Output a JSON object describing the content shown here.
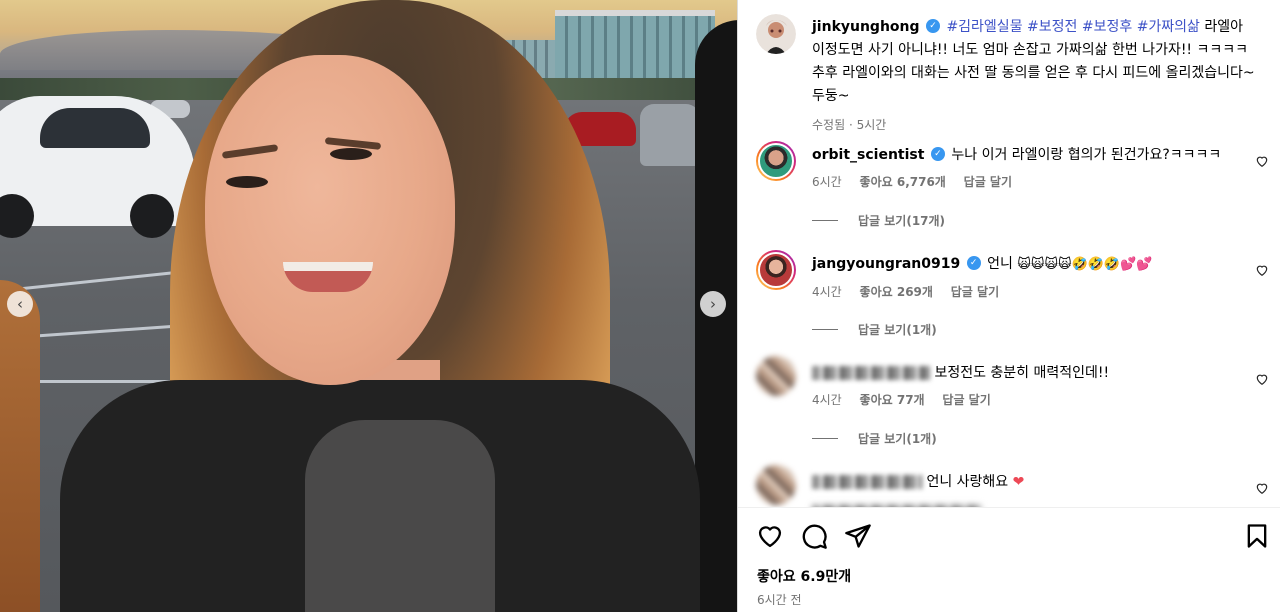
{
  "post": {
    "author": "jinkyunghong",
    "hashtags": [
      "#김라엘실물",
      "#보정전",
      "#보정후",
      "#가짜의삶"
    ],
    "caption_text": "라엘아 이정도면 사기 아니냐!! 너도 엄마 손잡고 가짜의삶 한번 나가자!! ㅋㅋㅋㅋ추후 라엘이와의 대화는 사전 딸 동의를 얻은 후 다시 피드에 올리겠습니다~ 두둥~",
    "edited_label": "수정됨",
    "time_ago": "5시간"
  },
  "comments": [
    {
      "username": "orbit_scientist",
      "verified": true,
      "text": "누나 이거 라엘이랑 협의가 된건가요?ㅋㅋㅋㅋ",
      "time": "6시간",
      "likes": "좋아요 6,776개",
      "reply_label": "답글 달기",
      "view_replies": "답글 보기(17개)"
    },
    {
      "username": "jangyoungran0919",
      "verified": true,
      "text": "언니",
      "emojis": "🙀🙀🙀🙀🤣🤣🤣💕💕",
      "time": "4시간",
      "likes": "좋아요 269개",
      "reply_label": "답글 달기",
      "view_replies": "답글 보기(1개)"
    },
    {
      "username_hidden": true,
      "text": "보정전도 충분히 매력적인데!!",
      "time": "4시간",
      "likes": "좋아요 77개",
      "reply_label": "답글 달기",
      "view_replies": "답글 보기(1개)"
    },
    {
      "username_hidden": true,
      "text": "언니 사랑해요",
      "emoji": "❤"
    }
  ],
  "actions": {
    "like_count": "좋아요 6.9만개",
    "posted_time": "6시간 전",
    "icons": [
      "heart-icon",
      "comment-icon",
      "share-icon",
      "bookmark-icon"
    ]
  },
  "media_nav": {
    "prev": "‹",
    "next": "›"
  },
  "colors": {
    "hashtag": "#3d52c7",
    "verified": "#3897f0",
    "heart_red": "#ed4956"
  }
}
